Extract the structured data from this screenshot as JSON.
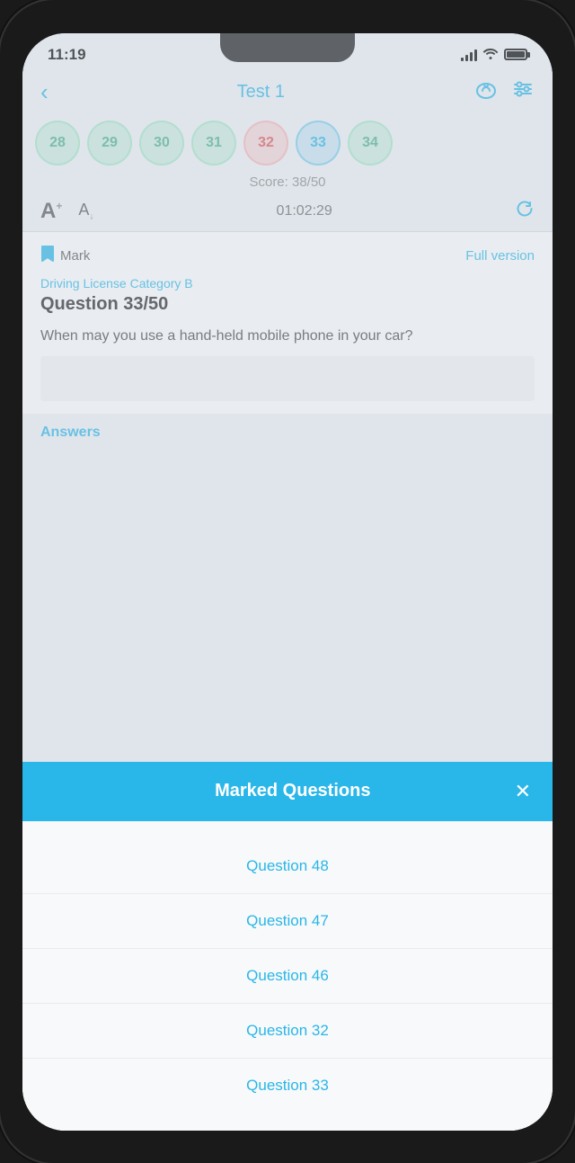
{
  "status": {
    "time": "11:19",
    "battery_icon": "🔋"
  },
  "header": {
    "title": "Test 1",
    "back_label": "‹",
    "cloud_icon": "☁",
    "settings_icon": "⚙"
  },
  "bubbles": [
    {
      "number": "28",
      "type": "green"
    },
    {
      "number": "29",
      "type": "green"
    },
    {
      "number": "30",
      "type": "green"
    },
    {
      "number": "31",
      "type": "green"
    },
    {
      "number": "32",
      "type": "red"
    },
    {
      "number": "33",
      "type": "active"
    },
    {
      "number": "34",
      "type": "green"
    }
  ],
  "score": {
    "label": "Score: 38/50"
  },
  "font_controls": {
    "timer": "01:02:29"
  },
  "question": {
    "mark_label": "Mark",
    "full_version_label": "Full version",
    "category": "Driving License Category B",
    "number_label": "Question 33/50",
    "text": "When may you use a hand-held mobile phone in your car?"
  },
  "answers": {
    "label": "Answers"
  },
  "modal": {
    "title": "Marked Questions",
    "close_label": "✕",
    "items": [
      {
        "label": "Question 48"
      },
      {
        "label": "Question 47"
      },
      {
        "label": "Question 46"
      },
      {
        "label": "Question 32"
      },
      {
        "label": "Question 33"
      }
    ]
  }
}
